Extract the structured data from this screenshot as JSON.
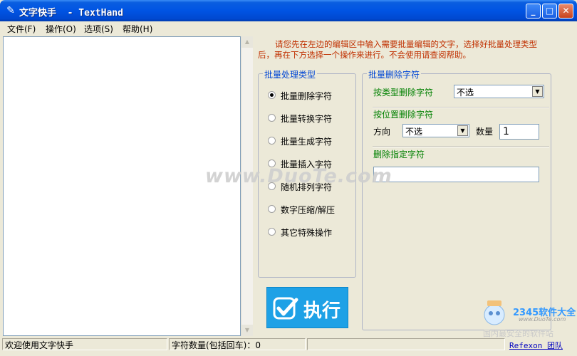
{
  "window": {
    "title": "文字快手  - TextHand",
    "icon": "pencil-icon",
    "controls": [
      "minimize",
      "maximize",
      "close"
    ]
  },
  "menu": [
    "文件(F)",
    "操作(O)",
    "选项(S)",
    "帮助(H)"
  ],
  "hint": "请您先在左边的编辑区中输入需要批量编辑的文字，选择好批量处理类型后，再在下方选择一个操作来进行。不会使用请查阅帮助。",
  "type_group": {
    "title": "批量处理类型",
    "options": [
      "批量删除字符",
      "批量转换字符",
      "批量生成字符",
      "批量插入字符",
      "随机排列字符",
      "数字压缩/解压",
      "其它特殊操作"
    ],
    "selected": "批量删除字符"
  },
  "op_group": {
    "title": "批量删除字符",
    "by_type": {
      "label": "按类型删除字符",
      "value": "不选"
    },
    "by_position": {
      "label": "按位置删除字符",
      "direction_label": "方向",
      "direction_value": "不选",
      "count_label": "数量",
      "count_value": "1"
    },
    "specified": {
      "label": "删除指定字符",
      "value": ""
    }
  },
  "execute_button": {
    "label": "执行",
    "icon": "check-icon"
  },
  "status": {
    "welcome": "欢迎使用文字快手",
    "char_count": "字符数量(包括回车)：0",
    "empty": "",
    "team": "Refexon 团队"
  },
  "watermark": {
    "text": "www.DuoTe.com",
    "corner_brand": "2345软件大全",
    "corner_url": "www.DuoTe.com",
    "corner_slogan": "国内最安全的软件站"
  },
  "colors": {
    "title_bar": "#0054e3",
    "hint_text": "#c03000",
    "group_title": "#0046d5",
    "section_label": "#008000",
    "execute_button": "#1ea1e6"
  }
}
